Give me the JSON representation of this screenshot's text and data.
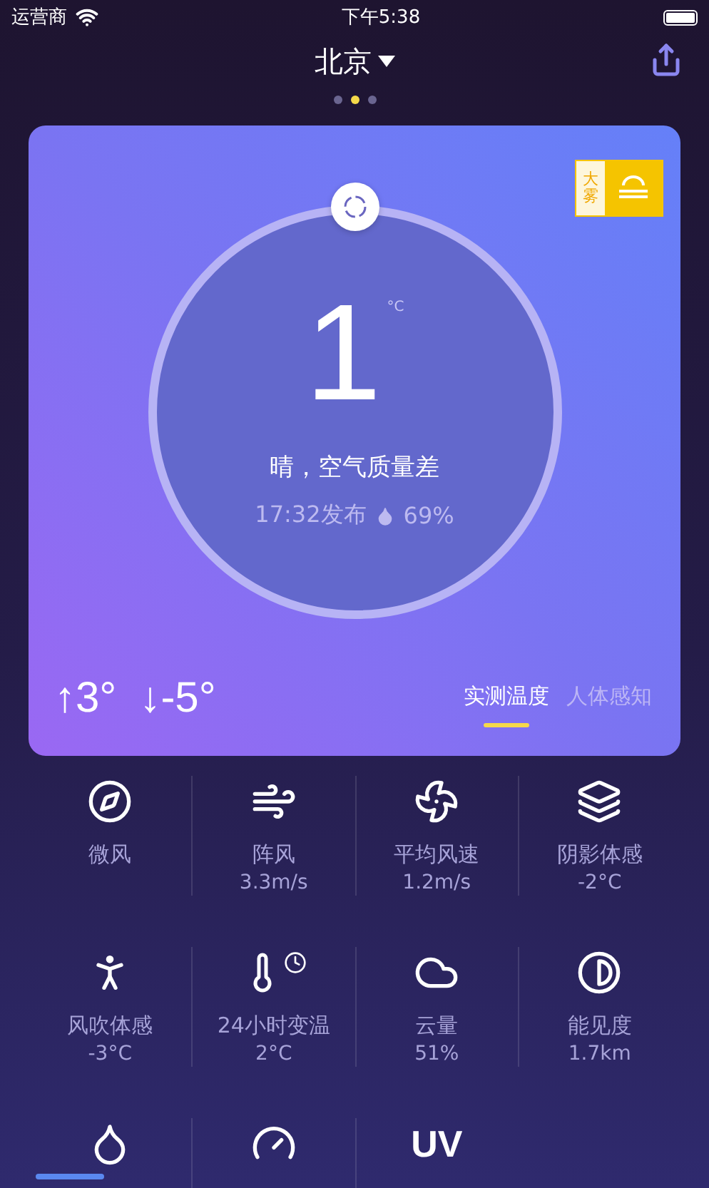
{
  "status_bar": {
    "carrier": "运营商",
    "time": "下午5:38"
  },
  "header": {
    "city": "北京"
  },
  "pages": [
    {
      "selected": false
    },
    {
      "selected": true
    },
    {
      "selected": false
    }
  ],
  "alert": {
    "label": "大雾"
  },
  "current": {
    "temperature": "1",
    "unit": "°C",
    "condition": "晴，空气质量差",
    "published": "17:32发布",
    "humidity": "69%",
    "high": "↑3°",
    "low": "↓-5°"
  },
  "temp_tabs": [
    {
      "label": "实测温度",
      "selected": true
    },
    {
      "label": "人体感知",
      "selected": false
    }
  ],
  "details": [
    {
      "label": "微风"
    },
    {
      "label": "阵风",
      "value": "3.3m/s"
    },
    {
      "label": "平均风速",
      "value": "1.2m/s"
    },
    {
      "label": "阴影体感",
      "value": "-2°C"
    },
    {
      "label": "风吹体感",
      "value": "-3°C"
    },
    {
      "label": "24小时变温",
      "value": "2°C"
    },
    {
      "label": "云量",
      "value": "51%"
    },
    {
      "label": "能见度",
      "value": "1.7km"
    },
    {
      "kind": "icon"
    },
    {
      "kind": "icon"
    },
    {
      "kind": "glyph",
      "glyph": "UV"
    }
  ]
}
